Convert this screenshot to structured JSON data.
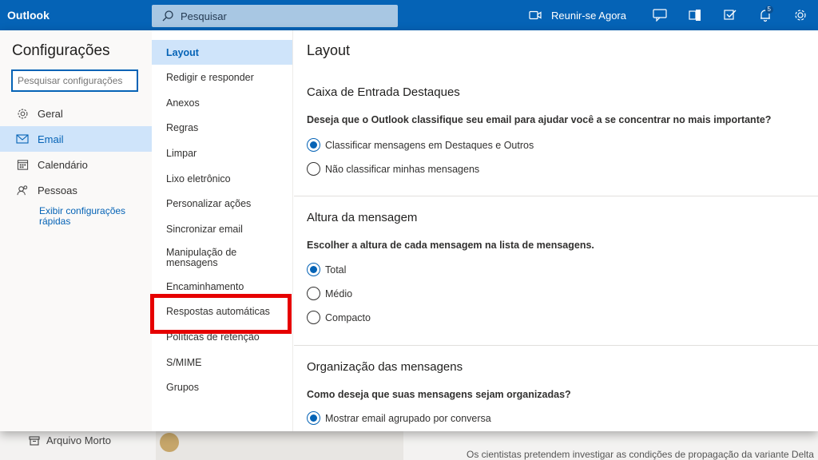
{
  "app": {
    "brand": "Outlook"
  },
  "search": {
    "placeholder": "Pesquisar"
  },
  "topbar": {
    "meet_now": "Reunir-se Agora",
    "notification_count": "5"
  },
  "background": {
    "archive": "Arquivo Morto",
    "preview_text": "Os cientistas pretendem investigar as condições de propagação da variante Delta"
  },
  "settings": {
    "title": "Configurações",
    "search_placeholder": "Pesquisar configurações",
    "nav": [
      {
        "label": "Geral",
        "icon": "gear-icon"
      },
      {
        "label": "Email",
        "icon": "mail-icon"
      },
      {
        "label": "Calendário",
        "icon": "calendar-icon"
      },
      {
        "label": "Pessoas",
        "icon": "people-icon"
      }
    ],
    "quick_link": "Exibir configurações rápidas"
  },
  "submenu": {
    "items": [
      "Layout",
      "Redigir e responder",
      "Anexos",
      "Regras",
      "Limpar",
      "Lixo eletrônico",
      "Personalizar ações",
      "Sincronizar email",
      "Manipulação de mensagens",
      "Encaminhamento",
      "Respostas automáticas",
      "Políticas de retenção",
      "S/MIME",
      "Grupos"
    ]
  },
  "content": {
    "title": "Layout",
    "focused": {
      "title": "Caixa de Entrada Destaques",
      "question": "Deseja que o Outlook classifique seu email para ajudar você a se concentrar no mais importante?",
      "options": [
        "Classificar mensagens em Destaques e Outros",
        "Não classificar minhas mensagens"
      ],
      "selected": 0
    },
    "height": {
      "title": "Altura da mensagem",
      "question": "Escolher a altura de cada mensagem na lista de mensagens.",
      "options": [
        "Total",
        "Médio",
        "Compacto"
      ],
      "selected": 0
    },
    "organization": {
      "title": "Organização das mensagens",
      "question": "Como deseja que suas mensagens sejam organizadas?",
      "options": [
        "Mostrar email agrupado por conversa"
      ],
      "selected": 0
    }
  },
  "colors": {
    "accent": "#0563b6",
    "highlight": "#e60000",
    "selected_bg": "#cfe4fa"
  }
}
